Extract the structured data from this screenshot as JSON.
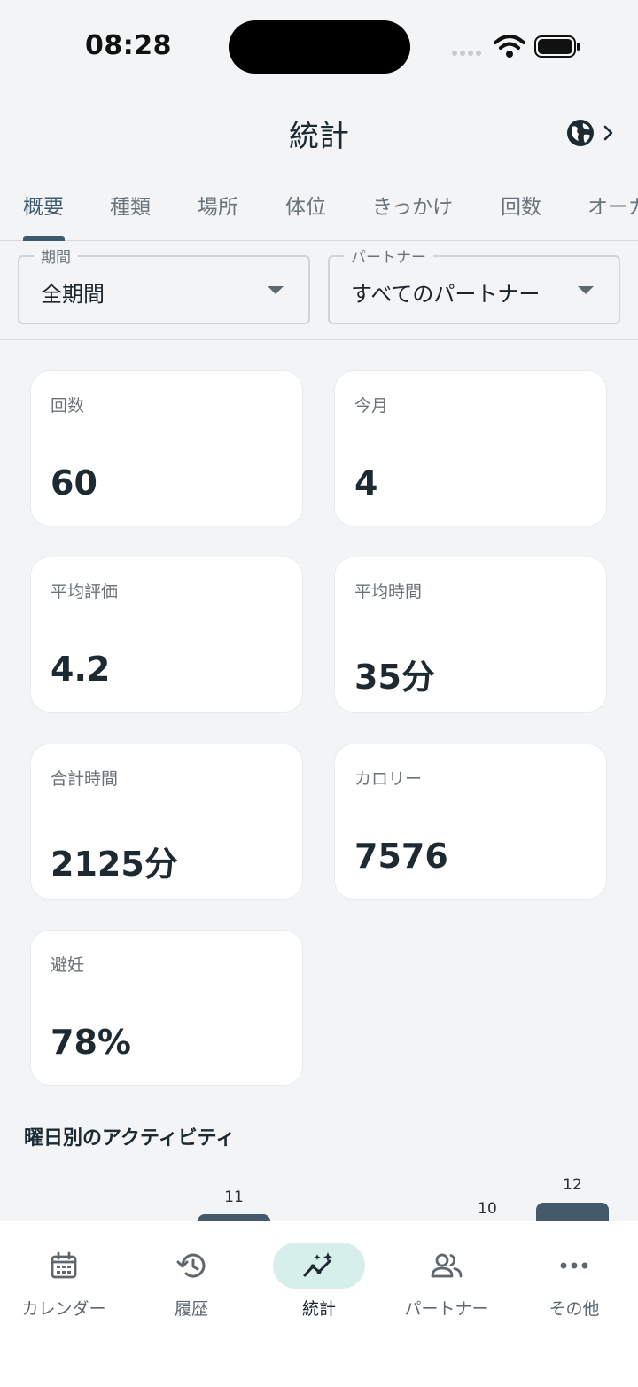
{
  "status_bar": {
    "time": "08:28"
  },
  "header": {
    "title": "統計"
  },
  "tabs": [
    {
      "label": "概要"
    },
    {
      "label": "種類"
    },
    {
      "label": "場所"
    },
    {
      "label": "体位"
    },
    {
      "label": "きっかけ"
    },
    {
      "label": "回数"
    },
    {
      "label": "オーガ"
    }
  ],
  "filters": {
    "period": {
      "label": "期間",
      "value": "全期間"
    },
    "partner": {
      "label": "パートナー",
      "value": "すべてのパートナー"
    }
  },
  "stats": [
    {
      "label": "回数",
      "value": "60"
    },
    {
      "label": "今月",
      "value": "4"
    },
    {
      "label": "平均評価",
      "value": "4.2"
    },
    {
      "label": "平均時間",
      "value": "35分"
    },
    {
      "label": "合計時間",
      "value": "2125分"
    },
    {
      "label": "カロリー",
      "value": "7576"
    },
    {
      "label": "避妊",
      "value": "78%"
    }
  ],
  "activity": {
    "title": "曜日別のアクティビティ",
    "visible_values": [
      "11",
      "10",
      "12"
    ]
  },
  "bottom_nav": [
    {
      "label": "カレンダー",
      "icon": "calendar-icon"
    },
    {
      "label": "履歴",
      "icon": "history-icon"
    },
    {
      "label": "統計",
      "icon": "trending-icon"
    },
    {
      "label": "パートナー",
      "icon": "people-icon"
    },
    {
      "label": "その他",
      "icon": "more-icon"
    }
  ],
  "colors": {
    "accent": "#3d5a6e",
    "bar": "#44596a",
    "nav_active_bg": "#d7efea",
    "background": "#f2f4f6"
  }
}
